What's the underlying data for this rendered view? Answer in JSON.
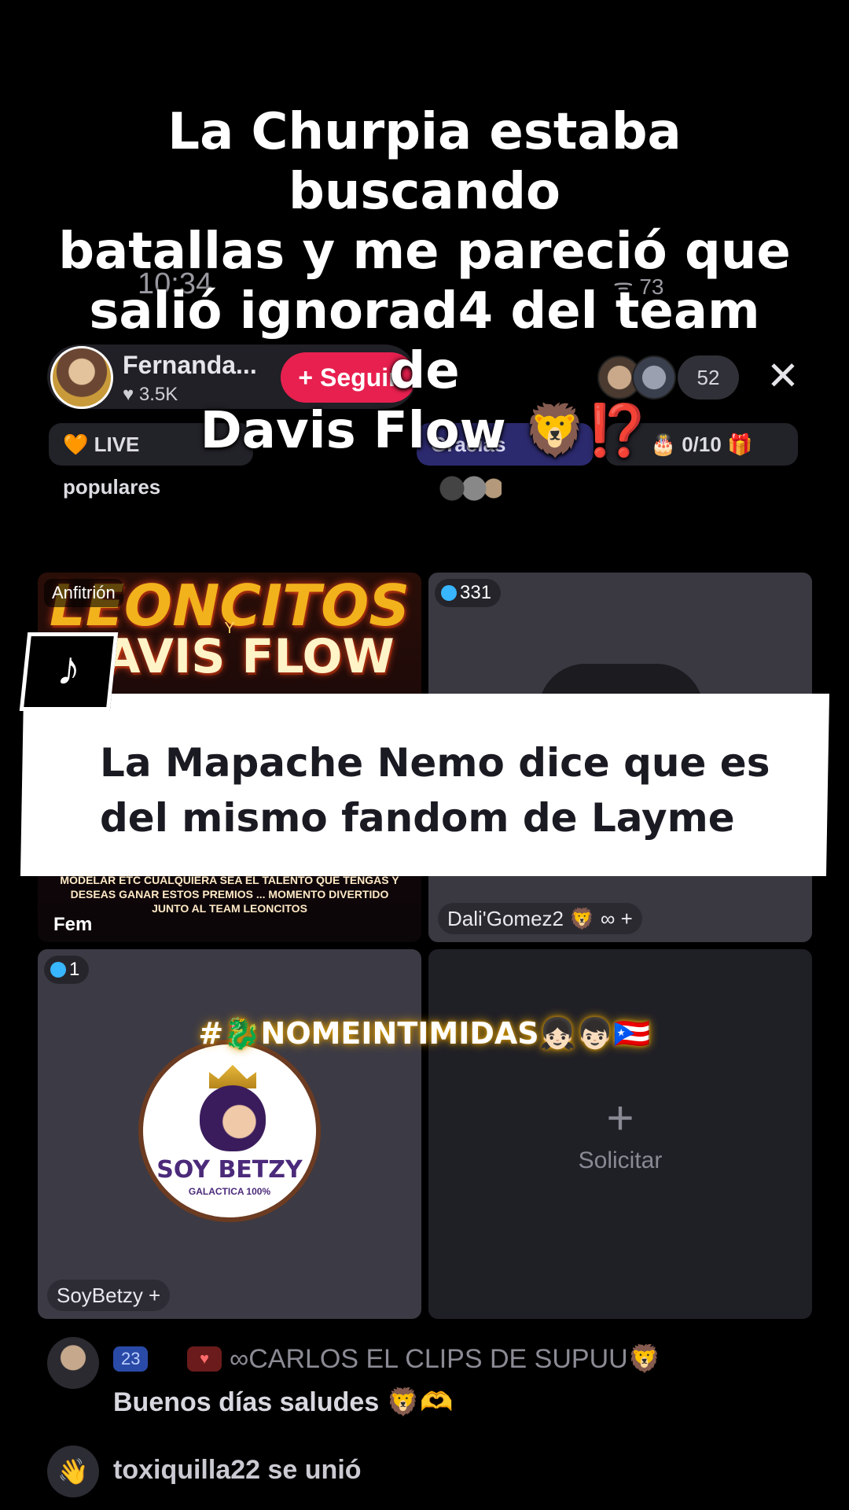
{
  "caption": {
    "line1": "La Churpia estaba buscando",
    "line2": "batallas y me pareció que",
    "line3": "salió ignorad4 del team de",
    "line4": "Davis Flow 🦁⁉️"
  },
  "status_bar": {
    "time": "10:34",
    "right": "ᯤ 73"
  },
  "header": {
    "host_name": "Fernanda...",
    "host_likes": "♥ 3.5K",
    "follow_label": "+ Seguir",
    "viewer_count": "52",
    "close_label": "✕"
  },
  "chips": {
    "live_popular": "🧡 LIVE populares",
    "gracias": "Gracias",
    "gift_progress": "0/10"
  },
  "tiles": {
    "host": {
      "badge": "Anfitrión",
      "banner_title": "LEONCITOS",
      "banner_y": "Y",
      "banner_sub": "DAVIS FLOW",
      "footer_text": "MODELAR ETC CUALQUIERA SEA EL TALENTO QUE TENGAS Y DESEAS GANAR ESTOS PREMIOS ... MOMENTO DIVERTIDO JUNTO AL TEAM LEONCITOS",
      "user": "Fem"
    },
    "dali": {
      "gems": "331",
      "user": "Dali'Gomez2 🦁 ∞ + "
    },
    "betzy": {
      "gems": "1",
      "logo_title": "SOY BETZY",
      "logo_sub": "GALACTICA 100%",
      "user": "SoyBetzy +"
    },
    "solicitar": {
      "plus": "+",
      "label": "Solicitar"
    }
  },
  "hashtag": "#🐉NOMEINTIMIDAS👧🏻👦🏻🇵🇷",
  "subtitle": {
    "line1": "La Mapache Nemo dice que es",
    "line2": "del mismo fandom de Layme"
  },
  "tiktok_logo": "♪",
  "chat": {
    "badge": "23",
    "user": "∞CARLOS EL CLIPS DE SUPUU🦁",
    "message": "Buenos días saludes 🦁🫶",
    "join_user": "toxiquilla22",
    "join_text": "se unió"
  },
  "colors": {
    "follow_button": "#e8204f",
    "gracias_chip": "#2c2a6e",
    "gem": "#38b6ff",
    "banner_gold": "#f2b21c"
  }
}
